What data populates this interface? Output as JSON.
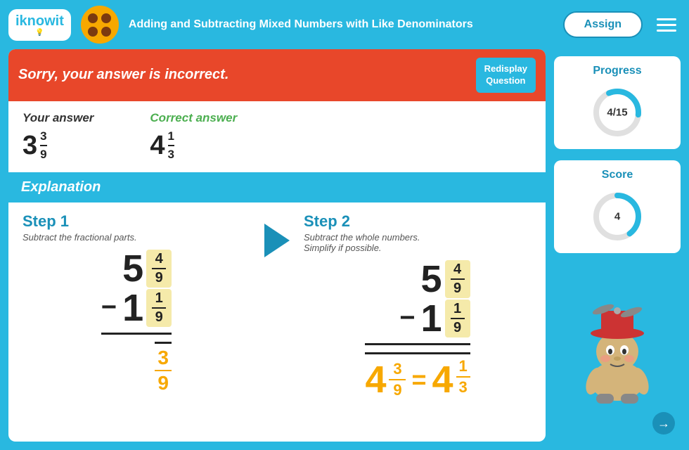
{
  "header": {
    "logo": "iknowit",
    "logo_sub": "💡",
    "title": "Adding and Subtracting Mixed Numbers with Like Denominators",
    "assign_label": "Assign"
  },
  "feedback": {
    "incorrect_message": "Sorry, your answer is incorrect.",
    "redisplay_label": "Redisplay\nQuestion"
  },
  "answers": {
    "your_answer_label": "Your answer",
    "correct_answer_label": "Correct answer",
    "your_whole": "3",
    "your_num": "3",
    "your_den": "9",
    "correct_whole": "4",
    "correct_num": "1",
    "correct_den": "3"
  },
  "explanation": {
    "title": "Explanation"
  },
  "steps": {
    "step1_title": "Step 1",
    "step1_desc": "Subtract the fractional parts.",
    "step2_title": "Step 2",
    "step2_desc": "Subtract the whole numbers.\nSimplify if possible."
  },
  "math": {
    "top_whole": "5",
    "top_num": "4",
    "top_den": "9",
    "bottom_whole": "1",
    "bottom_num": "1",
    "bottom_den": "9",
    "result_num": "3",
    "result_den": "9",
    "final_whole": "4",
    "final_num": "1",
    "final_den": "3"
  },
  "progress": {
    "title": "Progress",
    "value": "4/15",
    "current": 4,
    "total": 15
  },
  "score": {
    "title": "Score",
    "value": "4"
  }
}
